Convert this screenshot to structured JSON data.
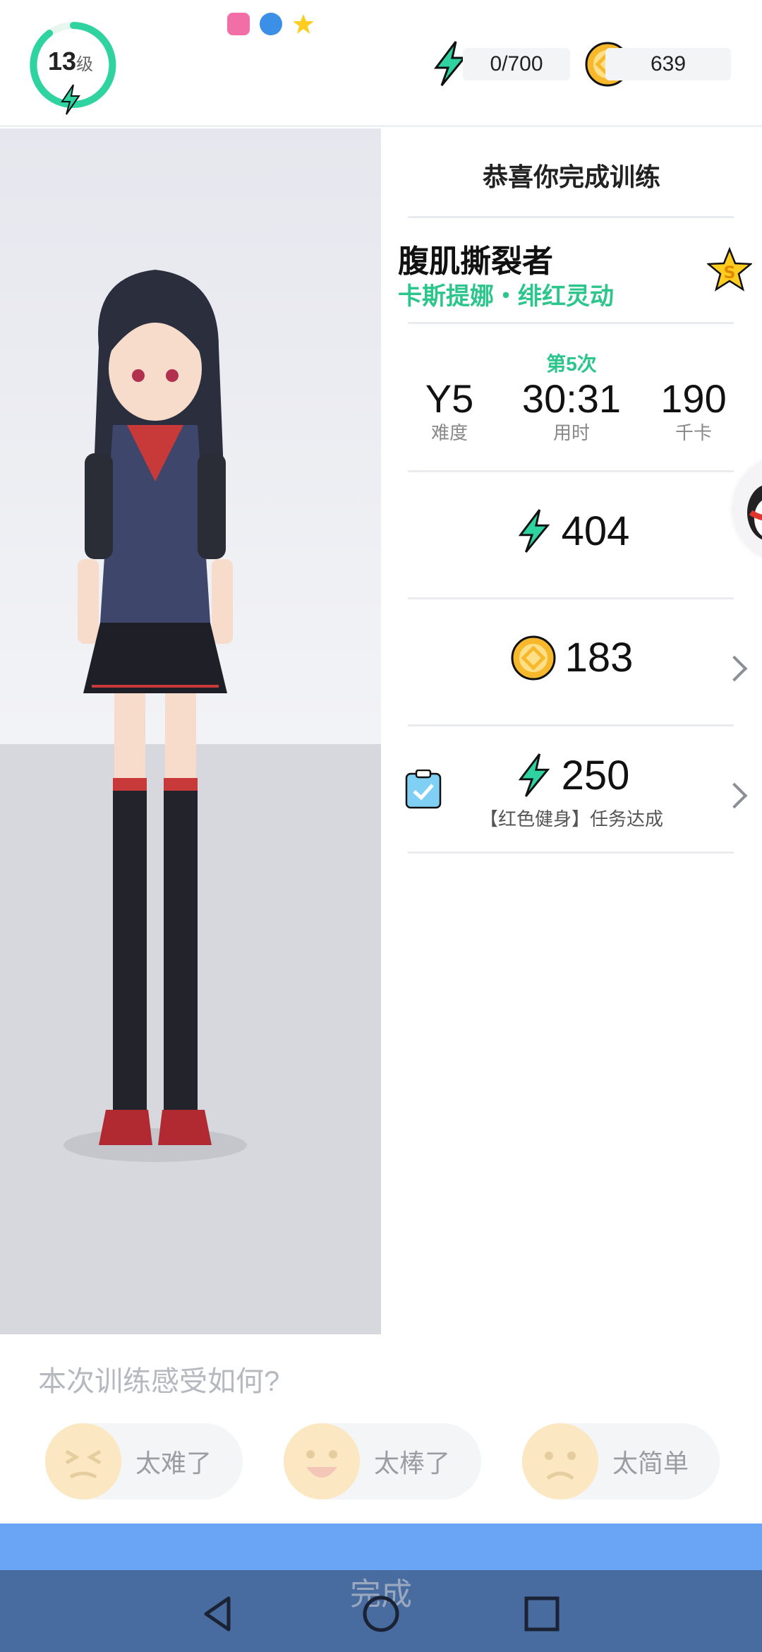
{
  "status_bar": {
    "app_icons": [
      "bilibili-icon",
      "globe-icon",
      "star-badge-icon"
    ]
  },
  "header": {
    "level_value": "13",
    "level_unit": "级",
    "energy_text": "0/700",
    "coins_text": "639"
  },
  "results": {
    "congrats_title": "恭喜你完成训练",
    "course_name": "腹肌撕裂者",
    "course_subtitle": "卡斯提娜・绯红灵动",
    "attempt_label": "第5次",
    "metrics": [
      {
        "value": "Y5",
        "label": "难度"
      },
      {
        "value": "30:31",
        "label": "用时"
      },
      {
        "value": "190",
        "label": "千卡"
      }
    ],
    "energy_reward": "404",
    "coin_reward": "183",
    "task_reward": "250",
    "task_label": "【红色健身】任务达成"
  },
  "feedback": {
    "question": "本次训练感受如何?",
    "options": [
      {
        "label": "太难了",
        "face": "grimace-face-icon"
      },
      {
        "label": "太棒了",
        "face": "laugh-face-icon"
      },
      {
        "label": "太简单",
        "face": "frown-face-icon"
      }
    ]
  },
  "footer": {
    "done_label": "完成"
  },
  "colors": {
    "accent_green": "#2cc58c",
    "energy_teal": "#2ed3a0",
    "coin_orange": "#f7b82b",
    "done_blue": "#6aa4f5",
    "nav_blue": "#486c9f"
  }
}
